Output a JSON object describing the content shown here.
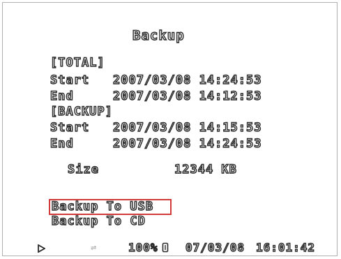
{
  "title": "Backup",
  "total": {
    "header": "[TOTAL]",
    "start_label": "Start",
    "start_value": "2007/03/08 14:24:53",
    "end_label": "End",
    "end_value": "2007/03/08 14:12:53"
  },
  "backup": {
    "header": "[BACKUP]",
    "start_label": "Start",
    "start_value": "2007/03/08 14:15:53",
    "end_label": "End",
    "end_value": "2007/03/08 14:24:53"
  },
  "size": {
    "label": "Size",
    "value": "12344 KB"
  },
  "menu": {
    "items": [
      {
        "label": "Backup To USB",
        "selected": true
      },
      {
        "label": "Backup To CD",
        "selected": false
      }
    ]
  },
  "status": {
    "percent": "100%",
    "date": "07/03/08",
    "time": "16:01:42",
    "play_icon": "play-icon",
    "network_icon": "network-link-icon",
    "hdd_icon": "hdd-icon"
  },
  "colors": {
    "selection": "#d23a3a",
    "text_outline": "#2a2a2a",
    "text_fill": "#ffffff"
  }
}
